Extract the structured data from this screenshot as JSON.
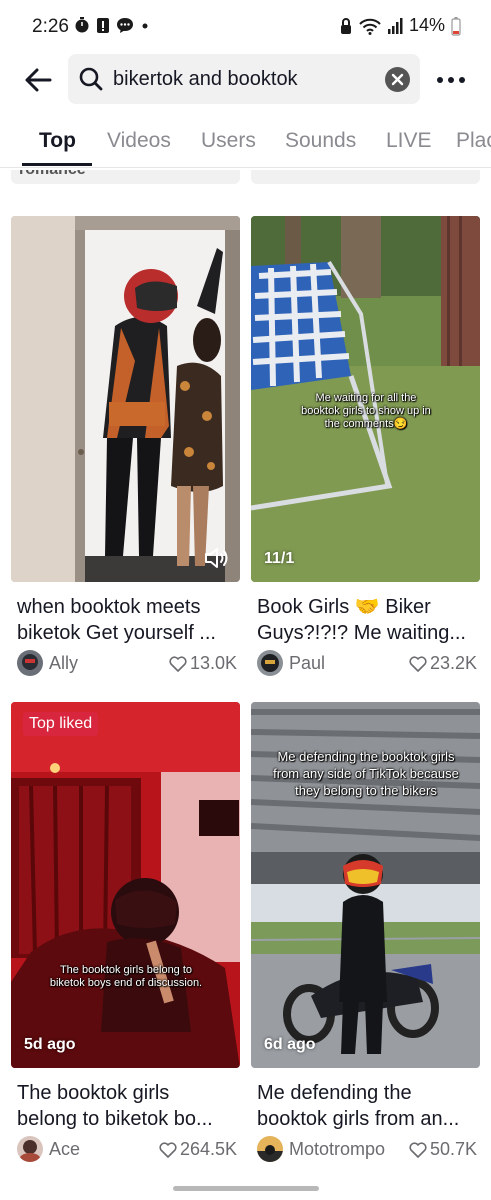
{
  "status_bar": {
    "time": "2:26",
    "battery": "14%"
  },
  "search": {
    "query": "bikertok and booktok"
  },
  "tabs": [
    {
      "label": "Top",
      "active": true
    },
    {
      "label": "Videos",
      "active": false
    },
    {
      "label": "Users",
      "active": false
    },
    {
      "label": "Sounds",
      "active": false
    },
    {
      "label": "LIVE",
      "active": false
    },
    {
      "label": "Plac",
      "active": false
    }
  ],
  "prev_row_stub": {
    "left_text": "romance"
  },
  "results": [
    {
      "caption_line1": "when booktok meets",
      "caption_line2": "biketok Get yourself ...",
      "author": "Ally",
      "likes": "13.0K",
      "overlay": "",
      "badge": "",
      "corner_label": ""
    },
    {
      "caption_line1": "Book Girls 🤝 Biker",
      "caption_line2": "Guys?!?!? Me waiting...",
      "author": "Paul",
      "likes": "23.2K",
      "overlay": "Me waiting for all the booktok girls to show up in the comments😏",
      "badge": "",
      "corner_label": "11/1"
    },
    {
      "caption_line1": "The booktok girls",
      "caption_line2": "belong to biketok bo...",
      "author": "Ace",
      "likes": "264.5K",
      "overlay": "The booktok girls belong to biketok boys end of discussion.",
      "badge": "Top liked",
      "corner_label": "5d ago"
    },
    {
      "caption_line1": "Me defending the",
      "caption_line2": "booktok girls from an...",
      "author": "Mototrompo",
      "likes": "50.7K",
      "overlay": "Me defending the booktok girls from any side of TikTok because they belong to the bikers",
      "badge": "",
      "corner_label": "6d ago"
    }
  ],
  "colors": {
    "accent_badge": "#d7263d",
    "search_bg": "#f1f1f2"
  }
}
